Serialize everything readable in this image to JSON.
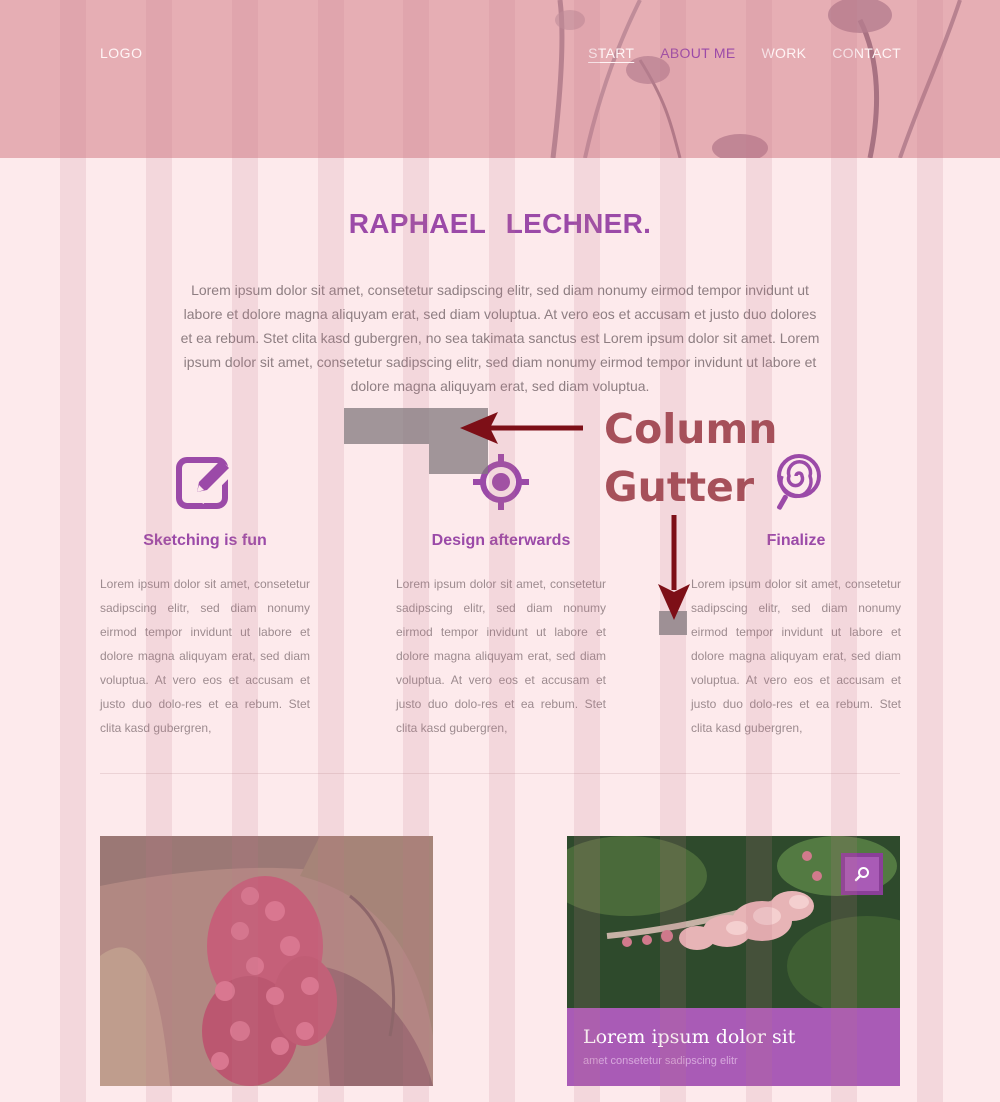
{
  "header": {
    "logo": "LOGO",
    "nav": [
      {
        "label": "START"
      },
      {
        "label": "ABOUT ME"
      },
      {
        "label": "WORK"
      },
      {
        "label": "CONTACT"
      }
    ]
  },
  "hero": {
    "title": "RAPHAEL LECHNER.",
    "intro": "Lorem ipsum dolor sit amet, consetetur sadipscing elitr, sed diam nonumy eirmod tempor invidunt ut labore et dolore magna aliquyam erat, sed diam voluptua. At vero eos et accusam et justo duo dolores et ea rebum. Stet clita kasd gubergren, no sea takimata sanctus est Lorem ipsum dolor sit amet. Lorem ipsum dolor sit amet, consetetur sadipscing elitr, sed diam nonumy eirmod tempor invidunt ut labore et dolore magna aliquyam erat, sed diam voluptua."
  },
  "features": [
    {
      "icon": "edit-icon",
      "title": "Sketching is fun",
      "text": "Lorem ipsum dolor sit amet, consetetur sadipscing elitr, sed diam nonumy eirmod tempor invidunt ut labore et dolore magna aliquyam erat, sed diam voluptua. At vero eos et accusam et justo duo dolo-res et ea rebum. Stet clita kasd gubergren,"
    },
    {
      "icon": "target-icon",
      "title": "Design afterwards",
      "text": "Lorem ipsum dolor sit amet, consetetur sadipscing elitr, sed diam nonumy eirmod tempor invidunt ut labore et dolore magna aliquyam erat, sed diam voluptua. At vero eos et accusam et justo duo dolo-res et ea rebum. Stet clita kasd gubergren,"
    },
    {
      "icon": "lollipop-icon",
      "title": "Finalize",
      "text": "Lorem ipsum dolor sit amet, consetetur sadipscing elitr, sed diam nonumy eirmod tempor invidunt ut labore et dolore magna aliquyam erat, sed diam voluptua. At vero eos et accusam et justo duo dolo-res et ea rebum. Stet clita kasd gubergren,"
    }
  ],
  "card": {
    "title": "Lorem ipsum dolor sit",
    "subtitle": "amet consetetur sadipscing elitr",
    "zoom_icon": "search-icon"
  },
  "annotation": {
    "line1": "Column",
    "line2": "Gutter"
  },
  "colors": {
    "accent": "#9b4aa8",
    "header_bg": "#e6aeb4",
    "page_bg": "#fdeaec",
    "annotation": "#a6505a",
    "arrow": "#7d0f17"
  }
}
